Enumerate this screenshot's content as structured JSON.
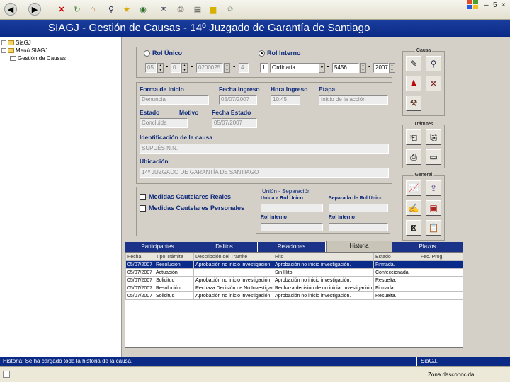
{
  "app": {
    "title": "SIAGJ - Gestión de Causas - 14º Juzgado de Garantía de Santiago"
  },
  "tree": {
    "root": "SiaGJ",
    "menu": "Menú SIAGJ",
    "item": "Gestión de Causas"
  },
  "window_controls": {
    "minimize": "–",
    "restore": "5",
    "close": "×"
  },
  "rol": {
    "unico_label": "Rol Único",
    "interno_label": "Rol Interno",
    "unico_values": [
      "05",
      "0",
      "0200025",
      "4"
    ],
    "interno_values": [
      "1",
      "Ordinaria",
      "5456",
      "2007"
    ]
  },
  "datos": {
    "forma_inicio_label": "Forma de Inicio",
    "forma_inicio_value": "Denuncia",
    "fecha_ingreso_label": "Fecha Ingreso",
    "fecha_ingreso_value": "05/07/2007",
    "hora_ingreso_label": "Hora Ingreso",
    "hora_ingreso_value": "10:45",
    "etapa_label": "Etapa",
    "etapa_value": "Inicio de la acción",
    "estado_label": "Estado",
    "estado_value": "Concluida",
    "motivo_label": "Motivo",
    "fecha_estado_label": "Fecha Estado",
    "fecha_estado_value": "05/07/2007",
    "identificacion_label": "Identificación de la causa",
    "identificacion_value": "SUPUÉS N.N.",
    "ubicacion_label": "Ubicación",
    "ubicacion_value": "14º JUZGADO DE GARANTÍA DE SANTIAGO"
  },
  "medidas": {
    "reales": "Medidas Cautelares Reales",
    "personales": "Medidas Cautelares Personales"
  },
  "relacion": {
    "legend": "Unión - Separación",
    "unida_label": "Unida a Rol Único:",
    "separada_label": "Separada de Rol Único:",
    "rol_interno_1": "Rol Interno",
    "rol_interno_2": "Rol Interno"
  },
  "icon_groups": {
    "causa": "Causa",
    "tramites": "Trámites",
    "general": "General"
  },
  "tabs": [
    "Participantes",
    "Delitos",
    "Relaciones",
    "Historia",
    "Plazos"
  ],
  "table": {
    "headers": [
      "Fecha",
      "Tipo Trámite",
      "Descripción del Trámite",
      "Hito",
      "Estado",
      "Fec. Prog."
    ],
    "rows": [
      [
        "05/07/2007",
        "Resolución",
        "Aprobación no inicio investigación",
        "Aprobación no inicio investigación.",
        "Firmada.",
        ""
      ],
      [
        "05/07/2007",
        "Actuación",
        "",
        "Sin Hito.",
        "Confeccionada.",
        ""
      ],
      [
        "05/07/2007",
        "Solicitud",
        "Aprobación no inicio investigación",
        "Aprobación no inicio investigación.",
        "Resuelta.",
        ""
      ],
      [
        "05/07/2007",
        "Resolución",
        "Rechaza Decisión de No Investigar",
        "Rechaza decisión de no iniciar investigación",
        "Firmada.",
        ""
      ],
      [
        "05/07/2007",
        "Solicitud",
        "Aprobación no inicio investigación",
        "Aprobación no inicio investigación.",
        "Resuelta.",
        ""
      ]
    ]
  },
  "status": {
    "message": "Historia: Se ha cargado toda la historia de la causa.",
    "right": "SiaGJ.",
    "zone": "Zona desconocida"
  },
  "colors": {
    "banner": "#0a2a86",
    "tab": "#1a3388",
    "label": "#0e2a7a"
  }
}
